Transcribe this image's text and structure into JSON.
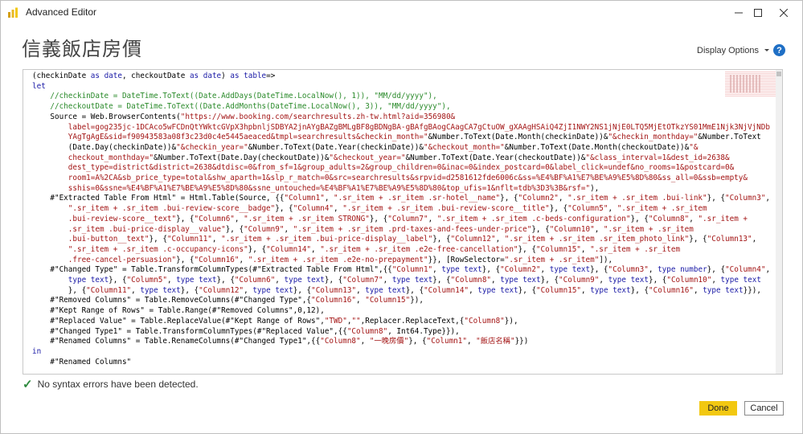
{
  "window": {
    "title": "Advanced Editor",
    "controls": {
      "minimize": "minimize-icon",
      "maximize": "maximize-icon",
      "close": "close-icon"
    }
  },
  "header": {
    "query_name": "信義飯店房價",
    "display_options_label": "Display Options",
    "help_label": "?"
  },
  "editor": {
    "lines": [
      [
        {
          "t": "(checkinDate "
        },
        {
          "t": "as",
          "c": "kw"
        },
        {
          "t": " "
        },
        {
          "t": "date",
          "c": "kw"
        },
        {
          "t": ", checkoutDate "
        },
        {
          "t": "as",
          "c": "kw"
        },
        {
          "t": " "
        },
        {
          "t": "date",
          "c": "kw"
        },
        {
          "t": ") "
        },
        {
          "t": "as",
          "c": "kw"
        },
        {
          "t": " "
        },
        {
          "t": "table",
          "c": "kw"
        },
        {
          "t": "=>"
        }
      ],
      [
        {
          "t": "let",
          "c": "kw"
        }
      ],
      [
        {
          "t": "    "
        },
        {
          "t": "//checkinDate = DateTime.ToText((Date.AddDays(DateTime.LocalNow(), 1)), \"MM/dd/yyyy\"),",
          "c": "cm"
        }
      ],
      [
        {
          "t": "    "
        },
        {
          "t": "//checkoutDate = DateTime.ToText((Date.AddMonths(DateTime.LocalNow(), 3)), \"MM/dd/yyyy\"),",
          "c": "cm"
        }
      ],
      [
        {
          "t": "    Source = Web.BrowserContents("
        },
        {
          "t": "\"https://www.booking.com/searchresults.zh-tw.html?aid=356980&",
          "c": "st"
        }
      ],
      [
        {
          "t": "        label=gog235jc-1DCAco5wFCDnQtYWktcGVpX3hpbnljSDBYA2jnAYgBAZgBMLgBF8gBDNgBA-gBAfgBAogCAagCA7gCtuOW_gXAAgHSAiQ4ZjI1NWY2NS1jNjE0LTQ5MjEtOTkzYS01MmE1Njk3NjVjNDb",
          "c": "st"
        }
      ],
      [
        {
          "t": "        YAgTgAgE&sid=f90943583a08f3c23d0c4e5445aeaced&tmpl=searchresults&checkin_month=\"",
          "c": "st"
        },
        {
          "t": "&Number.ToText(Date.Month(checkinDate))&"
        },
        {
          "t": "\"&checkin_monthday=\"",
          "c": "st"
        },
        {
          "t": "&Number.ToText"
        }
      ],
      [
        {
          "t": "        (Date.Day(checkinDate))&"
        },
        {
          "t": "\"&checkin_year=\"",
          "c": "st"
        },
        {
          "t": "&Number.ToText(Date.Year(checkinDate))&"
        },
        {
          "t": "\"&checkout_month=\"",
          "c": "st"
        },
        {
          "t": "&Number.ToText(Date.Month(checkoutDate))&"
        },
        {
          "t": "\"&",
          "c": "st"
        }
      ],
      [
        {
          "t": "        checkout_monthday=\"",
          "c": "st"
        },
        {
          "t": "&Number.ToText(Date.Day(checkoutDate))&"
        },
        {
          "t": "\"&checkout_year=\"",
          "c": "st"
        },
        {
          "t": "&Number.ToText(Date.Year(checkoutDate))&"
        },
        {
          "t": "\"&class_interval=1&dest_id=2638&",
          "c": "st"
        }
      ],
      [
        {
          "t": "        dest_type=district&district=2638&dtdisc=0&from_sf=1&group_adults=2&group_children=0&inac=0&index_postcard=0&label_click=undef&no_rooms=1&postcard=0&",
          "c": "st"
        }
      ],
      [
        {
          "t": "        room1=A%2CA&sb_price_type=total&shw_aparth=1&slp_r_match=0&src=searchresults&srpvid=d2581612fde6006c&ss=%E4%BF%A1%E7%BE%A9%E5%8D%80&ss_all=0&ssb=empty&",
          "c": "st"
        }
      ],
      [
        {
          "t": "        sshis=0&ssne=%E4%BF%A1%E7%BE%A9%E5%8D%80&ssne_untouched=%E4%BF%A1%E7%BE%A9%E5%8D%80&top_ufis=1&nflt=tdb%3D3%3B&rsf=\"",
          "c": "st"
        },
        {
          "t": "),"
        }
      ],
      [
        {
          "t": "    #\"Extracted Table From Html\" = Html.Table(Source, {{"
        },
        {
          "t": "\"Column1\"",
          "c": "st"
        },
        {
          "t": ", "
        },
        {
          "t": "\".sr_item + .sr_item .sr-hotel__name\"",
          "c": "st"
        },
        {
          "t": "}, {"
        },
        {
          "t": "\"Column2\"",
          "c": "st"
        },
        {
          "t": ", "
        },
        {
          "t": "\".sr_item + .sr_item .bui-link\"",
          "c": "st"
        },
        {
          "t": "}, {"
        },
        {
          "t": "\"Column3\"",
          "c": "st"
        },
        {
          "t": ","
        }
      ],
      [
        {
          "t": "        "
        },
        {
          "t": "\".sr_item + .sr_item .bui-review-score__badge\"",
          "c": "st"
        },
        {
          "t": "}, {"
        },
        {
          "t": "\"Column4\"",
          "c": "st"
        },
        {
          "t": ", "
        },
        {
          "t": "\".sr_item + .sr_item .bui-review-score__title\"",
          "c": "st"
        },
        {
          "t": "}, {"
        },
        {
          "t": "\"Column5\"",
          "c": "st"
        },
        {
          "t": ", "
        },
        {
          "t": "\".sr_item + .sr_item",
          "c": "st"
        }
      ],
      [
        {
          "t": "        .bui-review-score__text\"",
          "c": "st"
        },
        {
          "t": "}, {"
        },
        {
          "t": "\"Column6\"",
          "c": "st"
        },
        {
          "t": ", "
        },
        {
          "t": "\".sr_item + .sr_item STRONG\"",
          "c": "st"
        },
        {
          "t": "}, {"
        },
        {
          "t": "\"Column7\"",
          "c": "st"
        },
        {
          "t": ", "
        },
        {
          "t": "\".sr_item + .sr_item .c-beds-configuration\"",
          "c": "st"
        },
        {
          "t": "}, {"
        },
        {
          "t": "\"Column8\"",
          "c": "st"
        },
        {
          "t": ", "
        },
        {
          "t": "\".sr_item + ",
          "c": "st"
        }
      ],
      [
        {
          "t": "        .sr_item .bui-price-display__value\"",
          "c": "st"
        },
        {
          "t": "}, {"
        },
        {
          "t": "\"Column9\"",
          "c": "st"
        },
        {
          "t": ", "
        },
        {
          "t": "\".sr_item + .sr_item .prd-taxes-and-fees-under-price\"",
          "c": "st"
        },
        {
          "t": "}, {"
        },
        {
          "t": "\"Column10\"",
          "c": "st"
        },
        {
          "t": ", "
        },
        {
          "t": "\".sr_item + .sr_item",
          "c": "st"
        }
      ],
      [
        {
          "t": "        .bui-button__text\"",
          "c": "st"
        },
        {
          "t": "}, {"
        },
        {
          "t": "\"Column11\"",
          "c": "st"
        },
        {
          "t": ", "
        },
        {
          "t": "\".sr_item + .sr_item .bui-price-display__label\"",
          "c": "st"
        },
        {
          "t": "}, {"
        },
        {
          "t": "\"Column12\"",
          "c": "st"
        },
        {
          "t": ", "
        },
        {
          "t": "\".sr_item + .sr_item .sr_item_photo_link\"",
          "c": "st"
        },
        {
          "t": "}, {"
        },
        {
          "t": "\"Column13\"",
          "c": "st"
        },
        {
          "t": ","
        }
      ],
      [
        {
          "t": "        "
        },
        {
          "t": "\".sr_item + .sr_item .c-occupancy-icons\"",
          "c": "st"
        },
        {
          "t": "}, {"
        },
        {
          "t": "\"Column14\"",
          "c": "st"
        },
        {
          "t": ", "
        },
        {
          "t": "\".sr_item + .sr_item .e2e-free-cancellation\"",
          "c": "st"
        },
        {
          "t": "}, {"
        },
        {
          "t": "\"Column15\"",
          "c": "st"
        },
        {
          "t": ", "
        },
        {
          "t": "\".sr_item + .sr_item",
          "c": "st"
        }
      ],
      [
        {
          "t": "        .free-cancel-persuasion\"",
          "c": "st"
        },
        {
          "t": "}, {"
        },
        {
          "t": "\"Column16\"",
          "c": "st"
        },
        {
          "t": ", "
        },
        {
          "t": "\".sr_item + .sr_item .e2e-no-prepayment\"",
          "c": "st"
        },
        {
          "t": "}}, [RowSelector="
        },
        {
          "t": "\".sr_item + .sr_item\"",
          "c": "st"
        },
        {
          "t": "]),"
        }
      ],
      [
        {
          "t": "    #\"Changed Type\" = Table.TransformColumnTypes(#\"Extracted Table From Html\",{{"
        },
        {
          "t": "\"Column1\"",
          "c": "st"
        },
        {
          "t": ", "
        },
        {
          "t": "type",
          "c": "kw"
        },
        {
          "t": " "
        },
        {
          "t": "text",
          "c": "kw"
        },
        {
          "t": "}, {"
        },
        {
          "t": "\"Column2\"",
          "c": "st"
        },
        {
          "t": ", "
        },
        {
          "t": "type",
          "c": "kw"
        },
        {
          "t": " "
        },
        {
          "t": "text",
          "c": "kw"
        },
        {
          "t": "}, {"
        },
        {
          "t": "\"Column3\"",
          "c": "st"
        },
        {
          "t": ", "
        },
        {
          "t": "type",
          "c": "kw"
        },
        {
          "t": " "
        },
        {
          "t": "number",
          "c": "kw"
        },
        {
          "t": "}, {"
        },
        {
          "t": "\"Column4\"",
          "c": "st"
        },
        {
          "t": ","
        }
      ],
      [
        {
          "t": "        "
        },
        {
          "t": "type",
          "c": "kw"
        },
        {
          "t": " "
        },
        {
          "t": "text",
          "c": "kw"
        },
        {
          "t": "}, {"
        },
        {
          "t": "\"Column5\"",
          "c": "st"
        },
        {
          "t": ", "
        },
        {
          "t": "type",
          "c": "kw"
        },
        {
          "t": " "
        },
        {
          "t": "text",
          "c": "kw"
        },
        {
          "t": "}, {"
        },
        {
          "t": "\"Column6\"",
          "c": "st"
        },
        {
          "t": ", "
        },
        {
          "t": "type",
          "c": "kw"
        },
        {
          "t": " "
        },
        {
          "t": "text",
          "c": "kw"
        },
        {
          "t": "}, {"
        },
        {
          "t": "\"Column7\"",
          "c": "st"
        },
        {
          "t": ", "
        },
        {
          "t": "type",
          "c": "kw"
        },
        {
          "t": " "
        },
        {
          "t": "text",
          "c": "kw"
        },
        {
          "t": "}, {"
        },
        {
          "t": "\"Column8\"",
          "c": "st"
        },
        {
          "t": ", "
        },
        {
          "t": "type",
          "c": "kw"
        },
        {
          "t": " "
        },
        {
          "t": "text",
          "c": "kw"
        },
        {
          "t": "}, {"
        },
        {
          "t": "\"Column9\"",
          "c": "st"
        },
        {
          "t": ", "
        },
        {
          "t": "type",
          "c": "kw"
        },
        {
          "t": " "
        },
        {
          "t": "text",
          "c": "kw"
        },
        {
          "t": "}, {"
        },
        {
          "t": "\"Column10\"",
          "c": "st"
        },
        {
          "t": ", "
        },
        {
          "t": "type",
          "c": "kw"
        },
        {
          "t": " "
        },
        {
          "t": "text",
          "c": "kw"
        }
      ],
      [
        {
          "t": "        }, {"
        },
        {
          "t": "\"Column11\"",
          "c": "st"
        },
        {
          "t": ", "
        },
        {
          "t": "type",
          "c": "kw"
        },
        {
          "t": " "
        },
        {
          "t": "text",
          "c": "kw"
        },
        {
          "t": "}, {"
        },
        {
          "t": "\"Column12\"",
          "c": "st"
        },
        {
          "t": ", "
        },
        {
          "t": "type",
          "c": "kw"
        },
        {
          "t": " "
        },
        {
          "t": "text",
          "c": "kw"
        },
        {
          "t": "}, {"
        },
        {
          "t": "\"Column13\"",
          "c": "st"
        },
        {
          "t": ", "
        },
        {
          "t": "type",
          "c": "kw"
        },
        {
          "t": " "
        },
        {
          "t": "text",
          "c": "kw"
        },
        {
          "t": "}, {"
        },
        {
          "t": "\"Column14\"",
          "c": "st"
        },
        {
          "t": ", "
        },
        {
          "t": "type",
          "c": "kw"
        },
        {
          "t": " "
        },
        {
          "t": "text",
          "c": "kw"
        },
        {
          "t": "}, {"
        },
        {
          "t": "\"Column15\"",
          "c": "st"
        },
        {
          "t": ", "
        },
        {
          "t": "type",
          "c": "kw"
        },
        {
          "t": " "
        },
        {
          "t": "text",
          "c": "kw"
        },
        {
          "t": "}, {"
        },
        {
          "t": "\"Column16\"",
          "c": "st"
        },
        {
          "t": ", "
        },
        {
          "t": "type",
          "c": "kw"
        },
        {
          "t": " "
        },
        {
          "t": "text",
          "c": "kw"
        },
        {
          "t": "}}),"
        }
      ],
      [
        {
          "t": "    #\"Removed Columns\" = Table.RemoveColumns(#\"Changed Type\",{"
        },
        {
          "t": "\"Column16\"",
          "c": "st"
        },
        {
          "t": ", "
        },
        {
          "t": "\"Column15\"",
          "c": "st"
        },
        {
          "t": "}),"
        }
      ],
      [
        {
          "t": "    #\"Kept Range of Rows\" = Table.Range(#\"Removed Columns\",0,12),"
        }
      ],
      [
        {
          "t": "    #\"Replaced Value\" = Table.ReplaceValue(#\"Kept Range of Rows\","
        },
        {
          "t": "\"TWD\"",
          "c": "st"
        },
        {
          "t": ","
        },
        {
          "t": "\"\"",
          "c": "st"
        },
        {
          "t": ",Replacer.ReplaceText,{"
        },
        {
          "t": "\"Column8\"",
          "c": "st"
        },
        {
          "t": "}),"
        }
      ],
      [
        {
          "t": "    #\"Changed Type1\" = Table.TransformColumnTypes(#\"Replaced Value\",{{"
        },
        {
          "t": "\"Column8\"",
          "c": "st"
        },
        {
          "t": ", Int64.Type}}),"
        }
      ],
      [
        {
          "t": "    #\"Renamed Columns\" = Table.RenameColumns(#\"Changed Type1\",{{"
        },
        {
          "t": "\"Column8\"",
          "c": "st"
        },
        {
          "t": ", "
        },
        {
          "t": "\"一晚房價\"",
          "c": "st"
        },
        {
          "t": "}, {"
        },
        {
          "t": "\"Column1\"",
          "c": "st"
        },
        {
          "t": ", "
        },
        {
          "t": "\"飯店名稱\"",
          "c": "st"
        },
        {
          "t": "}})"
        }
      ],
      [
        {
          "t": "in",
          "c": "kw"
        }
      ],
      [
        {
          "t": "    #\"Renamed Columns\""
        }
      ]
    ]
  },
  "status": {
    "icon": "check-icon",
    "text": "No syntax errors have been detected."
  },
  "footer": {
    "done_label": "Done",
    "cancel_label": "Cancel"
  },
  "colors": {
    "keyword": "#1a1aa6",
    "comment": "#2a8a2a",
    "string": "#a31515",
    "done_button": "#f2c811",
    "success": "#2f8a3f"
  }
}
